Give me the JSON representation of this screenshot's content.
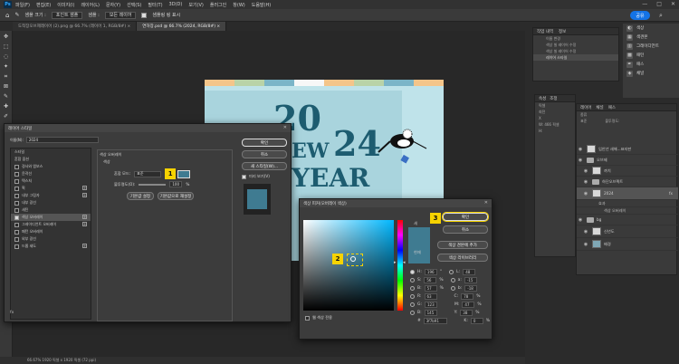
{
  "menu": {
    "logo": "Ps",
    "items": [
      "파일(F)",
      "편집(E)",
      "이미지(I)",
      "레이어(L)",
      "문자(Y)",
      "선택(S)",
      "필터(T)",
      "3D(D)",
      "보기(V)",
      "플러그인",
      "창(W)",
      "도움말(H)"
    ]
  },
  "window": {
    "minimize": "—",
    "maximize": "□",
    "close": "✕"
  },
  "options": {
    "sample_size_label": "샘플 크기 :",
    "sample_size_value": "포인트 샘플",
    "sample_label": "샘플 :",
    "sample_value": "모든 레이어",
    "show_ring": "샘플링 링 표시",
    "share": "공유"
  },
  "tabs": [
    "도착장오브제레이어 (2).png @ 66.7% (레이어 1, RGB/8#) ×",
    "연하장.psd @ 66.7% (2024, RGB/8#) ×"
  ],
  "doc": {
    "year_top": "20",
    "year_bottom": "24",
    "text_new": "EW",
    "text_year": "YEAR"
  },
  "status": "66.67%   1920 픽셀 x 1920 픽셀 (72 ppi)",
  "history": {
    "tab1": "작업 내역",
    "tab2": "정보",
    "rows": [
      "이름 변경",
      "색상 칠 레이어 수정",
      "색상 칠 레이어 수정",
      "레이어 스타일"
    ]
  },
  "colors_panel": {
    "items": [
      "색상",
      "색견본",
      "그레이디언트",
      "패턴",
      "패스",
      "채널"
    ]
  },
  "props": {
    "tab1": "속성",
    "tab2": "조정",
    "rows": [
      "픽셀",
      "회전",
      "X",
      "W: 466 픽셀",
      "H:"
    ]
  },
  "layers": {
    "tabs": [
      "레이어",
      "채널",
      "패스"
    ],
    "kind": "종류",
    "blend": "표준",
    "opacity_label": "불투명도:",
    "rows": [
      {
        "name": "입안년 새해...표지판",
        "type": "layer"
      },
      {
        "name": "오브제",
        "type": "folder"
      },
      {
        "name": "까치",
        "type": "layer"
      },
      {
        "name": "하단오브젝트",
        "type": "folder"
      },
      {
        "name": "2024",
        "type": "layer",
        "sel": true
      },
      {
        "name": "효과",
        "type": "sub"
      },
      {
        "name": "색상 오버레이",
        "type": "sub"
      },
      {
        "name": "bg",
        "type": "folder"
      },
      {
        "name": "신년도",
        "type": "layer"
      },
      {
        "name": "배경",
        "type": "layer"
      }
    ]
  },
  "layer_style": {
    "title": "레이어 스타일",
    "name_label": "이름(N):",
    "name_value": "2024",
    "list": [
      {
        "label": "스타일",
        "cb": null,
        "plus": false
      },
      {
        "label": "혼합 옵션",
        "cb": null,
        "plus": false
      },
      {
        "label": "경사와 엠보스",
        "cb": false,
        "plus": false
      },
      {
        "label": "윤곽선",
        "cb": false,
        "plus": false
      },
      {
        "label": "텍스처",
        "cb": false,
        "plus": false
      },
      {
        "label": "획",
        "cb": false,
        "plus": true
      },
      {
        "label": "내부 그림자",
        "cb": false,
        "plus": true
      },
      {
        "label": "내부 광선",
        "cb": false,
        "plus": false
      },
      {
        "label": "새틴",
        "cb": false,
        "plus": false
      },
      {
        "label": "색상 오버레이",
        "cb": true,
        "plus": true,
        "sel": true
      },
      {
        "label": "그레이디언트 오버레이",
        "cb": false,
        "plus": true
      },
      {
        "label": "패턴 오버레이",
        "cb": false,
        "plus": false
      },
      {
        "label": "외부 광선",
        "cb": false,
        "plus": false
      },
      {
        "label": "드롭 섀도",
        "cb": false,
        "plus": true
      }
    ],
    "section": "색상 오버레이",
    "subsection": "색상",
    "blend_label": "혼합 모드:",
    "blend_value": "표준",
    "opacity_label": "불투명도(O):",
    "opacity_value": "100",
    "pct": "%",
    "default_btn": "기본값 설정",
    "reset_btn": "기본값으로 재설정",
    "ok": "확인",
    "cancel": "취소",
    "new_style": "새 스타일(W)...",
    "preview": "미리 보기(V)",
    "fx": "fx"
  },
  "color_picker": {
    "title": "색상 피커(오버레이 색상)",
    "new_label": "새",
    "current_label": "현재",
    "ok": "확인",
    "cancel": "취소",
    "add_swatch": "색상 견본에 추가",
    "libraries": "색상 라이브러리",
    "web_only": "웹 색상 전용",
    "fields": [
      {
        "l": "H:",
        "v": "196",
        "u": "°",
        "l2": "L:",
        "v2": "48"
      },
      {
        "l": "S:",
        "v": "56",
        "u": "%",
        "l2": "a:",
        "v2": "-15"
      },
      {
        "l": "B:",
        "v": "57",
        "u": "%",
        "l2": "b:",
        "v2": "-18"
      },
      {
        "l": "R:",
        "v": "63",
        "u": "",
        "l2": "C:",
        "v2": "78",
        "u2": "%"
      },
      {
        "l": "G:",
        "v": "123",
        "u": "",
        "l2": "M:",
        "v2": "47",
        "u2": "%"
      },
      {
        "l": "B:",
        "v": "145",
        "u": "",
        "l2": "Y:",
        "v2": "38",
        "u2": "%"
      },
      {
        "l": "#",
        "v": "3f7b91",
        "u": "",
        "l2": "K:",
        "v2": "0",
        "u2": "%"
      }
    ]
  },
  "badges": {
    "b1": "1",
    "b2": "2",
    "b3": "3"
  },
  "accent": "#3f7b91"
}
